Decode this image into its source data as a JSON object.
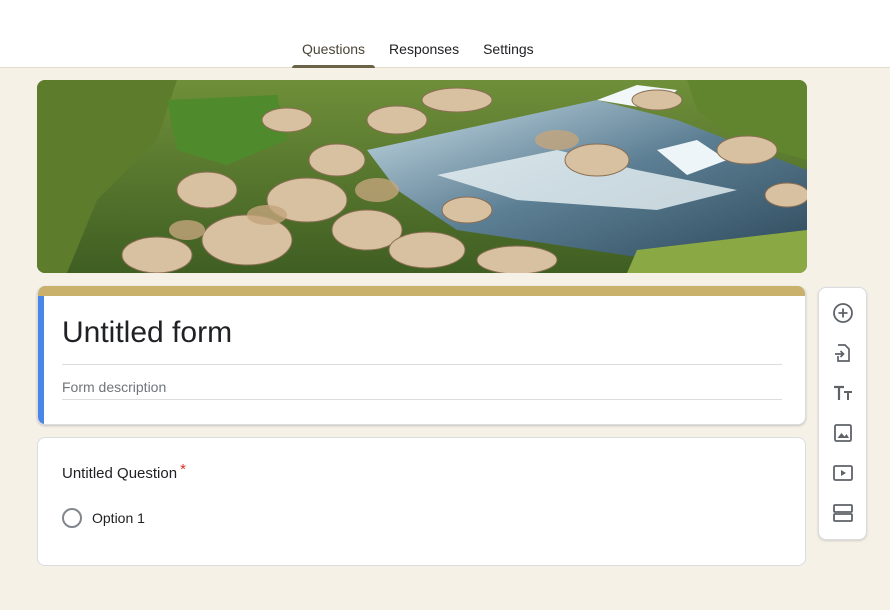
{
  "tabs": [
    {
      "label": "Questions",
      "active": true
    },
    {
      "label": "Responses",
      "active": false
    },
    {
      "label": "Settings",
      "active": false
    }
  ],
  "form": {
    "title": "Untitled form",
    "description_placeholder": "Form description"
  },
  "question": {
    "title": "Untitled Question",
    "required_marker": "*",
    "options": [
      "Option 1"
    ]
  },
  "toolbar": {
    "icons": [
      "add-question-icon",
      "import-questions-icon",
      "add-title-icon",
      "add-image-icon",
      "add-video-icon",
      "add-section-icon"
    ]
  },
  "theme": {
    "header_accent": "#c9b06b",
    "left_accent": "#4a86e8",
    "background": "#f6f1e7",
    "required": "#d93025"
  }
}
